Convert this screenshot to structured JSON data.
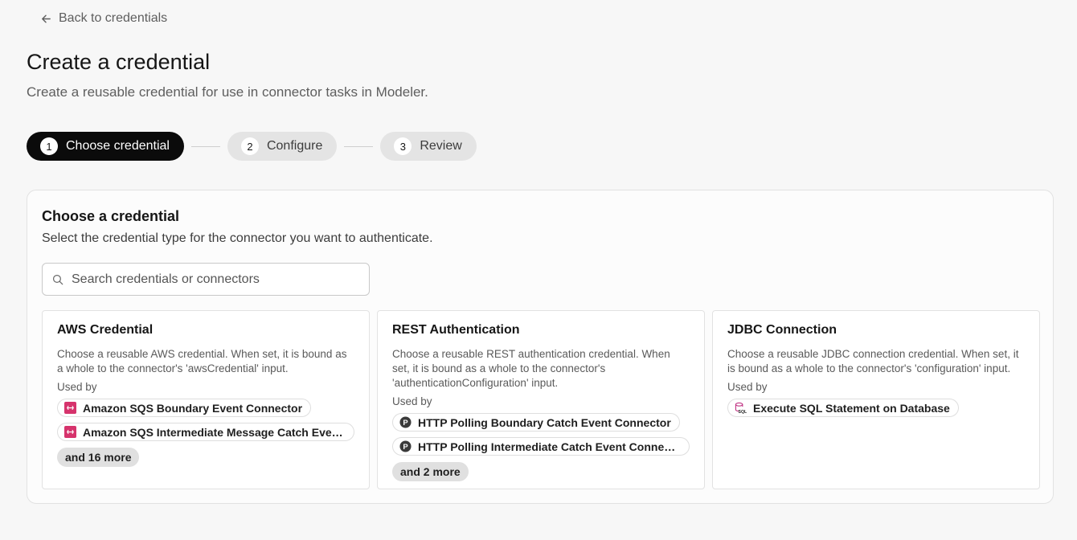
{
  "back_link": "Back to credentials",
  "title": "Create a credential",
  "subtitle": "Create a reusable credential for use in connector tasks in Modeler.",
  "steps": [
    {
      "num": "1",
      "label": "Choose credential"
    },
    {
      "num": "2",
      "label": "Configure"
    },
    {
      "num": "3",
      "label": "Review"
    }
  ],
  "panel": {
    "title": "Choose a credential",
    "description": "Select the credential type for the connector you want to authenticate.",
    "search_placeholder": "Search credentials or connectors"
  },
  "used_by_label": "Used by",
  "cards": [
    {
      "title": "AWS Credential",
      "description": "Choose a reusable AWS credential. When set, it is bound as a whole to the connector's 'awsCredential' input.",
      "connectors": [
        "Amazon SQS Boundary Event Connector",
        "Amazon SQS Intermediate Message Catch Event Connector"
      ],
      "more": "and 16 more"
    },
    {
      "title": "REST Authentication",
      "description": "Choose a reusable REST authentication credential. When set, it is bound as a whole to the connector's 'authenticationConfiguration' input.",
      "connectors": [
        "HTTP Polling Boundary Catch Event Connector",
        "HTTP Polling Intermediate Catch Event Connector"
      ],
      "more": "and 2 more"
    },
    {
      "title": "JDBC Connection",
      "description": "Choose a reusable JDBC connection credential. When set, it is bound as a whole to the connector's 'configuration' input.",
      "connectors": [
        "Execute SQL Statement on Database"
      ]
    }
  ],
  "colors": {
    "active_step": "#0b0b0b",
    "sqs_icon": "#d6336c",
    "http_icon": "#3a3a3a"
  }
}
